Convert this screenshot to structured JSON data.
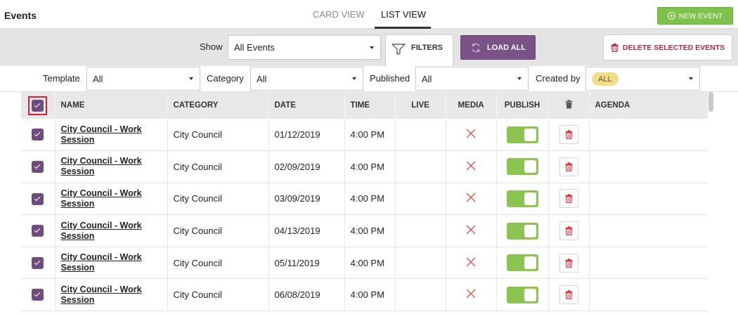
{
  "header": {
    "title": "Events",
    "tabs": [
      {
        "label": "CARD VIEW",
        "active": false
      },
      {
        "label": "LIST VIEW",
        "active": true
      }
    ],
    "new_event_label": "NEW EVENT"
  },
  "toolbar": {
    "show_label": "Show",
    "show_value": "All Events",
    "filters_label": "FILTERS",
    "load_all_label": "LOAD ALL",
    "delete_selected_label": "DELETE SELECTED EVENTS"
  },
  "filters": {
    "template_label": "Template",
    "template_value": "All",
    "category_label": "Category",
    "category_value": "All",
    "published_label": "Published",
    "published_value": "All",
    "created_by_label": "Created by",
    "created_by_value": "ALL"
  },
  "table": {
    "columns": [
      "NAME",
      "CATEGORY",
      "DATE",
      "TIME",
      "LIVE",
      "MEDIA",
      "PUBLISH",
      "AGENDA"
    ],
    "rows": [
      {
        "name": "City Council - Work Session",
        "category": "City Council",
        "date": "01/12/2019",
        "time": "4:00 PM",
        "checked": true,
        "published": true
      },
      {
        "name": "City Council - Work Session",
        "category": "City Council",
        "date": "02/09/2019",
        "time": "4:00 PM",
        "checked": true,
        "published": true
      },
      {
        "name": "City Council - Work Session",
        "category": "City Council",
        "date": "03/09/2019",
        "time": "4:00 PM",
        "checked": true,
        "published": true
      },
      {
        "name": "City Council - Work Session",
        "category": "City Council",
        "date": "04/13/2019",
        "time": "4:00 PM",
        "checked": true,
        "published": true
      },
      {
        "name": "City Council - Work Session",
        "category": "City Council",
        "date": "05/11/2019",
        "time": "4:00 PM",
        "checked": true,
        "published": true
      },
      {
        "name": "City Council - Work Session",
        "category": "City Council",
        "date": "06/08/2019",
        "time": "4:00 PM",
        "checked": true,
        "published": true
      }
    ]
  },
  "icons": {
    "new_event": "plus-circle-icon",
    "filters": "funnel-icon",
    "load_all": "refresh-icon",
    "delete": "trash-icon",
    "media_missing": "x-icon"
  },
  "colors": {
    "accent_purple": "#7a5288",
    "new_event_green": "#7dc24a",
    "publish_toggle": "#8cc452",
    "delete_red": "#b5293a",
    "highlight_outline": "#d42030"
  }
}
